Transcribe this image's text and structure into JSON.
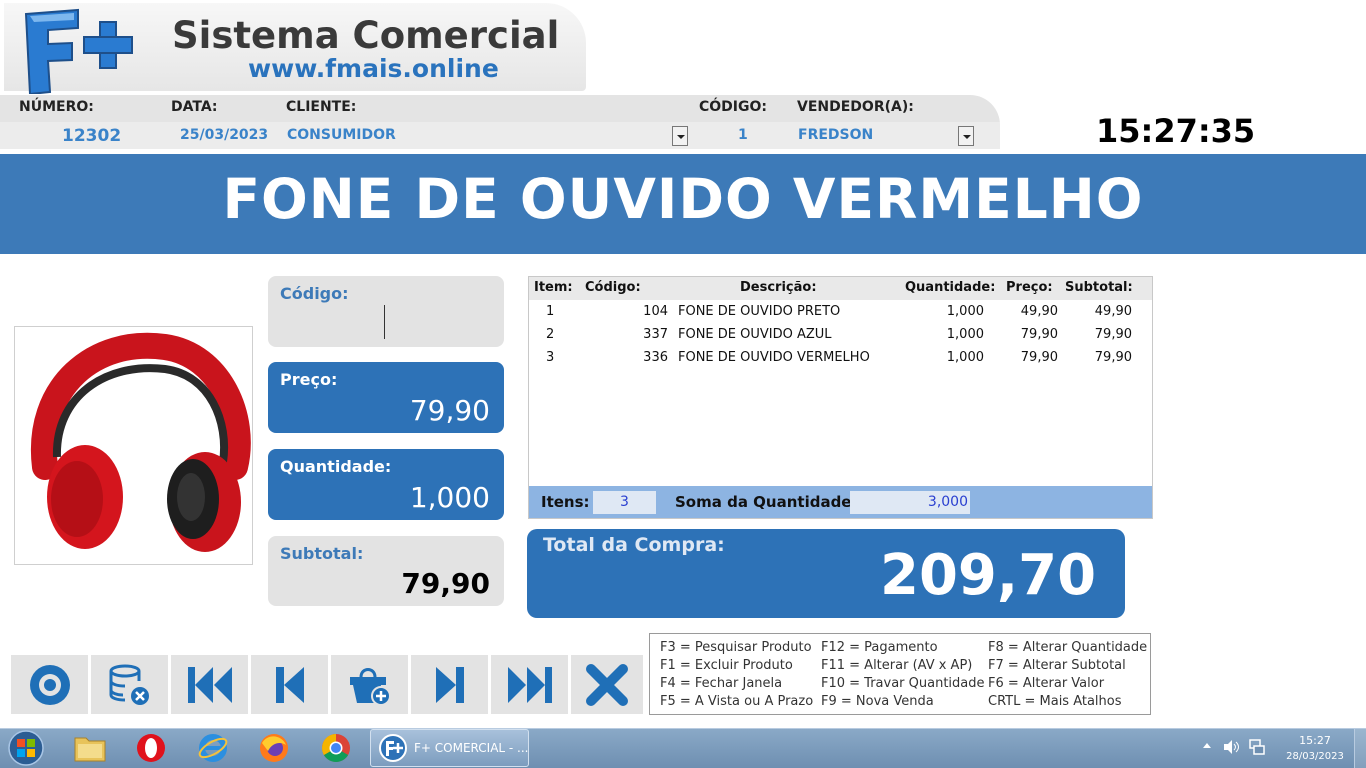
{
  "logo": {
    "mark": "F+",
    "title": "Sistema Comercial",
    "url": "www.fmais.online"
  },
  "header": {
    "numero_label": "NÚMERO:",
    "numero": "12302",
    "data_label": "DATA:",
    "data": "25/03/2023",
    "cliente_label": "CLIENTE:",
    "cliente": "CONSUMIDOR",
    "codigo_label": "CÓDIGO:",
    "codigo": "1",
    "vendedor_label": "VENDEDOR(A):",
    "vendedor": "FREDSON"
  },
  "clock": "15:27:35",
  "banner": "FONE DE OUVIDO VERMELHO",
  "fields": {
    "codigo_label": "Código:",
    "codigo_value": "",
    "preco_label": "Preço:",
    "preco_value": "79,90",
    "quantidade_label": "Quantidade:",
    "quantidade_value": "1,000",
    "subtotal_label": "Subtotal:",
    "subtotal_value": "79,90"
  },
  "table": {
    "headers": [
      "Item:",
      "Código:",
      "Descrição:",
      "Quantidade:",
      "Preço:",
      "Subtotal:"
    ],
    "rows": [
      [
        "1",
        "104",
        "FONE DE OUVIDO PRETO",
        "1,000",
        "49,90",
        "49,90"
      ],
      [
        "2",
        "337",
        "FONE DE OUVIDO AZUL",
        "1,000",
        "79,90",
        "79,90"
      ],
      [
        "3",
        "336",
        "FONE DE OUVIDO VERMELHO",
        "1,000",
        "79,90",
        "79,90"
      ]
    ],
    "itens_label": "Itens:",
    "itens_value": "3",
    "soma_label": "Soma da Quantidade:",
    "soma_value": "3,000"
  },
  "total": {
    "label": "Total da Compra:",
    "value": "209,70"
  },
  "toolbar": [
    "disc-icon",
    "database-delete-icon",
    "first-record-icon",
    "previous-record-icon",
    "add-basket-icon",
    "next-record-icon",
    "last-record-icon",
    "close-icon"
  ],
  "shortcuts": [
    [
      "F3 = Pesquisar Produto",
      "F12 = Pagamento",
      "F8 = Alterar Quantidade"
    ],
    [
      "F1 = Excluir Produto",
      "F11 = Alterar (AV x AP)",
      "F7 = Alterar Subtotal"
    ],
    [
      "F4 = Fechar Janela",
      "F10 = Travar Quantidade",
      "F6 = Alterar Valor"
    ],
    [
      "F5 = A Vista ou A Prazo",
      "F9 = Nova Venda",
      "CRTL = Mais Atalhos"
    ]
  ],
  "taskbar": {
    "app_label": "F+ COMERCIAL - ...",
    "time": "15:27",
    "date": "28/03/2023"
  },
  "colors": {
    "accent": "#2d72b7",
    "banner": "#3d7ab8",
    "label_blue": "#3a83c9"
  }
}
